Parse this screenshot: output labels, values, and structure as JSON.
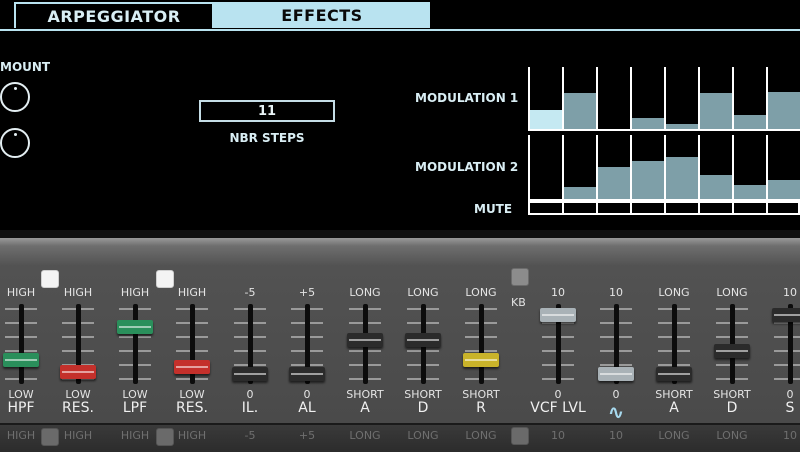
{
  "tabs": {
    "arpeggiator": "ARPEGGIATOR",
    "effects": "EFFECTS"
  },
  "arp": {
    "amount_label": "MOUNT",
    "steps_value": "11",
    "steps_label": "NBR STEPS",
    "modulation1_label": "MODULATION 1",
    "modulation2_label": "MODULATION 2",
    "mute_label": "MUTE",
    "modulation1_levels": [
      0.3,
      0.58,
      0.0,
      0.18,
      0.08,
      0.58,
      0.22,
      0.6
    ],
    "modulation1_highlight": [
      true,
      false,
      false,
      false,
      false,
      false,
      false,
      false
    ],
    "modulation2_levels": [
      0.0,
      0.18,
      0.5,
      0.6,
      0.65,
      0.38,
      0.22,
      0.3
    ]
  },
  "panel": {
    "kb_label": "KB",
    "faded_labels": [
      "HIGH",
      "HIGH",
      "HIGH",
      "HIGH",
      "-5",
      "+5",
      "LONG",
      "LONG",
      "LONG",
      "10",
      "10",
      "LONG",
      "LONG",
      "10"
    ],
    "sliders": [
      {
        "top": "HIGH",
        "low": "LOW",
        "name": "HPF",
        "value": 0.32,
        "color": "#2a8f5b"
      },
      {
        "top": "HIGH",
        "low": "LOW",
        "name": "RES.",
        "value": 0.15,
        "color": "#c4302b"
      },
      {
        "top": "HIGH",
        "low": "LOW",
        "name": "LPF",
        "value": 0.78,
        "color": "#2a8f5b"
      },
      {
        "top": "HIGH",
        "low": "LOW",
        "name": "RES.",
        "value": 0.22,
        "color": "#c4302b"
      },
      {
        "top": "-5",
        "low": "0",
        "name": "IL.",
        "value": 0.12,
        "color": "#2b2b2b"
      },
      {
        "top": "+5",
        "low": "0",
        "name": "AL",
        "value": 0.12,
        "color": "#2b2b2b"
      },
      {
        "top": "LONG",
        "low": "SHORT",
        "name": "A",
        "value": 0.6,
        "color": "#2b2b2b"
      },
      {
        "top": "LONG",
        "low": "SHORT",
        "name": "D",
        "value": 0.6,
        "color": "#2b2b2b"
      },
      {
        "top": "LONG",
        "low": "SHORT",
        "name": "R",
        "value": 0.32,
        "color": "#c9b32a"
      },
      {
        "top": "10",
        "low": "0",
        "name": "VCF LVL",
        "value": 0.95,
        "color": "#a9b2b7"
      },
      {
        "top": "10",
        "low": "0",
        "name": "",
        "value": 0.12,
        "color": "#a9b2b7",
        "icon": "sine-wave-icon"
      },
      {
        "top": "LONG",
        "low": "SHORT",
        "name": "A",
        "value": 0.12,
        "color": "#2b2b2b"
      },
      {
        "top": "LONG",
        "low": "SHORT",
        "name": "D",
        "value": 0.45,
        "color": "#2b2b2b"
      },
      {
        "top": "10",
        "low": "0",
        "name": "S",
        "value": 0.95,
        "color": "#2b2b2b"
      }
    ],
    "accent": "#b9e3f0"
  }
}
